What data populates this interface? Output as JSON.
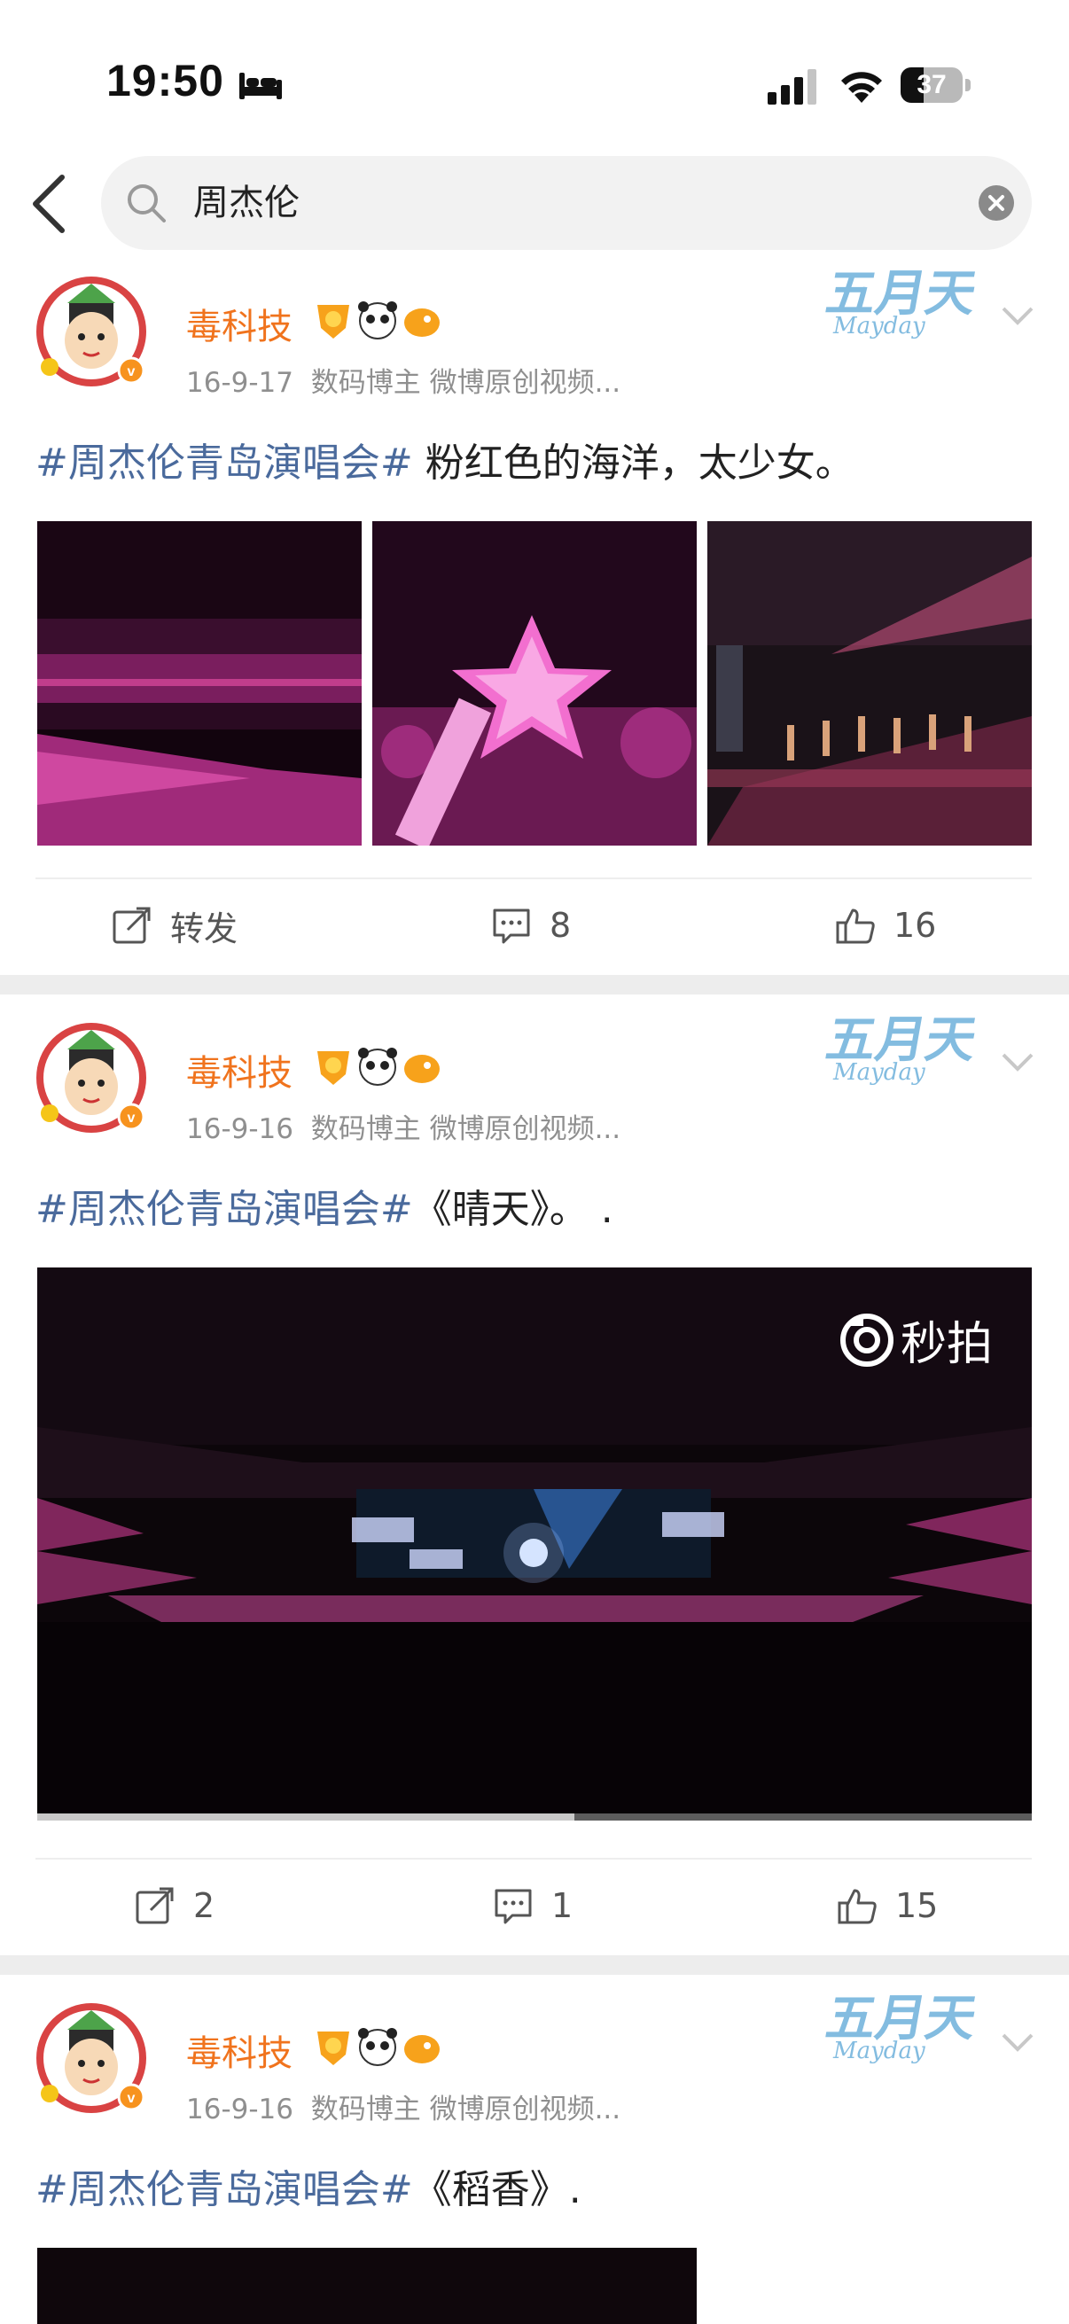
{
  "status_bar": {
    "time": "19:50",
    "battery": "37",
    "battery_level": 0.37
  },
  "search": {
    "query": "周杰伦"
  },
  "watermark_text": "五月天 Mayday",
  "posts": [
    {
      "author": "毒科技",
      "date": "16-9-17",
      "source": "数码博主 微博原创视频...",
      "hashtag": "#周杰伦青岛演唱会#",
      "text": "粉红色的海洋，太少女。",
      "actions": {
        "repost": "转发",
        "comment": "8",
        "like": "16"
      }
    },
    {
      "author": "毒科技",
      "date": "16-9-16",
      "source": "数码博主 微博原创视频...",
      "hashtag": "#周杰伦青岛演唱会#",
      "text": "《晴天》。 .",
      "video_logo": "秒拍",
      "video_progress": 0.54,
      "actions": {
        "repost": "2",
        "comment": "1",
        "like": "15"
      }
    },
    {
      "author": "毒科技",
      "date": "16-9-16",
      "source": "数码博主 微博原创视频...",
      "hashtag": "#周杰伦青岛演唱会#",
      "text": "《稻香》."
    }
  ],
  "colors": {
    "author": "#f0731d",
    "hashtag": "#4a6a9c",
    "meta": "#8f8f8f"
  }
}
